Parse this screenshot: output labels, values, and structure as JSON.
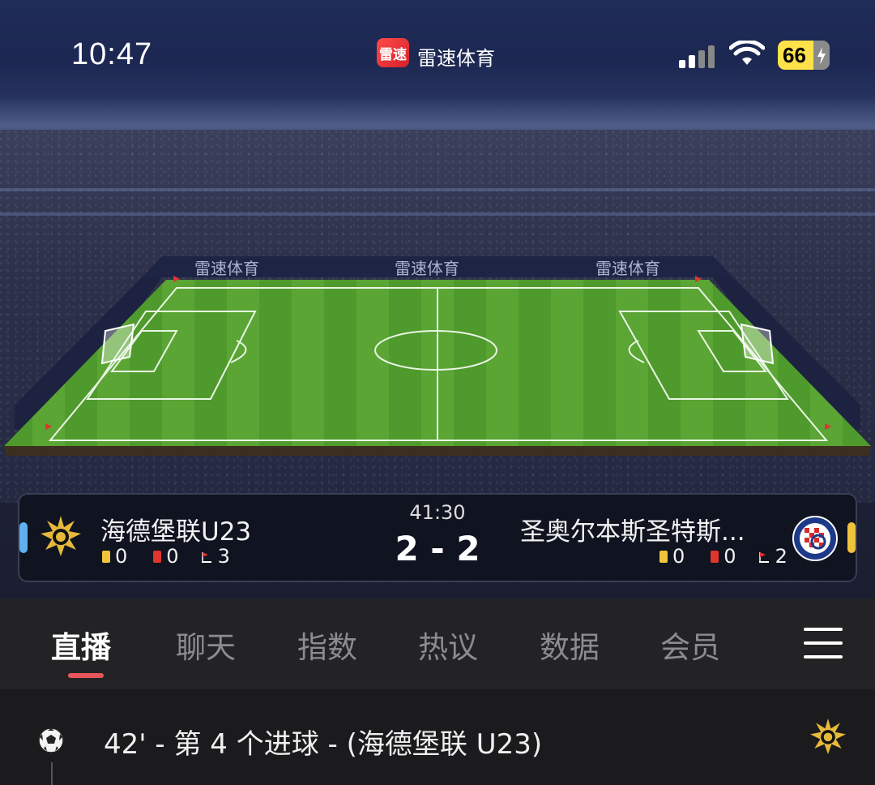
{
  "status_bar": {
    "time": "10:47",
    "app_logo_text": "雷速",
    "app_name": "雷速体育",
    "battery": "66"
  },
  "pitch": {
    "board_text": "雷速体育"
  },
  "match": {
    "clock": "41:30",
    "score": "2 - 2",
    "home": {
      "name": "海德堡联U23",
      "yellow": "0",
      "red": "0",
      "corners": "3",
      "bar_color": "#5fb1ee"
    },
    "away": {
      "name": "圣奥尔本斯圣特斯...",
      "yellow": "0",
      "red": "0",
      "corners": "2",
      "bar_color": "#f0c43a"
    }
  },
  "tabs": [
    {
      "label": "直播",
      "active": true
    },
    {
      "label": "聊天"
    },
    {
      "label": "指数"
    },
    {
      "label": "热议"
    },
    {
      "label": "数据"
    },
    {
      "label": "会员"
    }
  ],
  "events": [
    {
      "text": "42' - 第 4 个进球 - (海德堡联 U23)",
      "icon": "soccer-ball-icon"
    }
  ],
  "colors": {
    "accent": "#e9555a",
    "pitch_green": "#4d9a2a"
  }
}
